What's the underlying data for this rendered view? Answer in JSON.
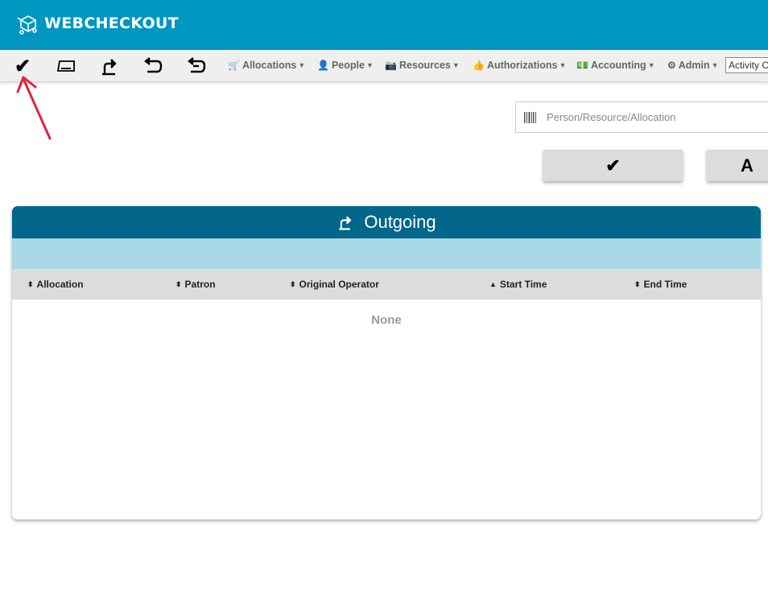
{
  "app": {
    "name": "WEBCHECKOUT"
  },
  "toolbar": {
    "icons": [
      "check-in-icon",
      "ticket-icon",
      "checkout-icon",
      "return-icon",
      "undo-return-icon"
    ],
    "checkin_glyph": "✔",
    "menus": [
      {
        "icon": "cart-icon",
        "label": "Allocations"
      },
      {
        "icon": "person-icon",
        "label": "People"
      },
      {
        "icon": "camera-icon",
        "label": "Resources"
      },
      {
        "icon": "thumbs-up-icon",
        "label": "Authorizations"
      },
      {
        "icon": "money-icon",
        "label": "Accounting"
      },
      {
        "icon": "gear-icon",
        "label": "Admin"
      }
    ],
    "activity_value": "Activity C"
  },
  "search": {
    "placeholder": "Person/Resource/Allocation"
  },
  "actions": {
    "confirm_glyph": "✔",
    "second_glyph": "A"
  },
  "panel": {
    "title": "Outgoing",
    "columns": [
      {
        "label": "Allocation",
        "sort": "both"
      },
      {
        "label": "Patron",
        "sort": "both"
      },
      {
        "label": "Original Operator",
        "sort": "both"
      },
      {
        "label": "Start Time",
        "sort": "up"
      },
      {
        "label": "End Time",
        "sort": "both"
      }
    ],
    "empty_text": "None"
  },
  "colors": {
    "header": "#0096bf",
    "panel_header": "#00668a",
    "panel_subheader": "#a9d8e6",
    "annotation_arrow": "#e0243c"
  }
}
